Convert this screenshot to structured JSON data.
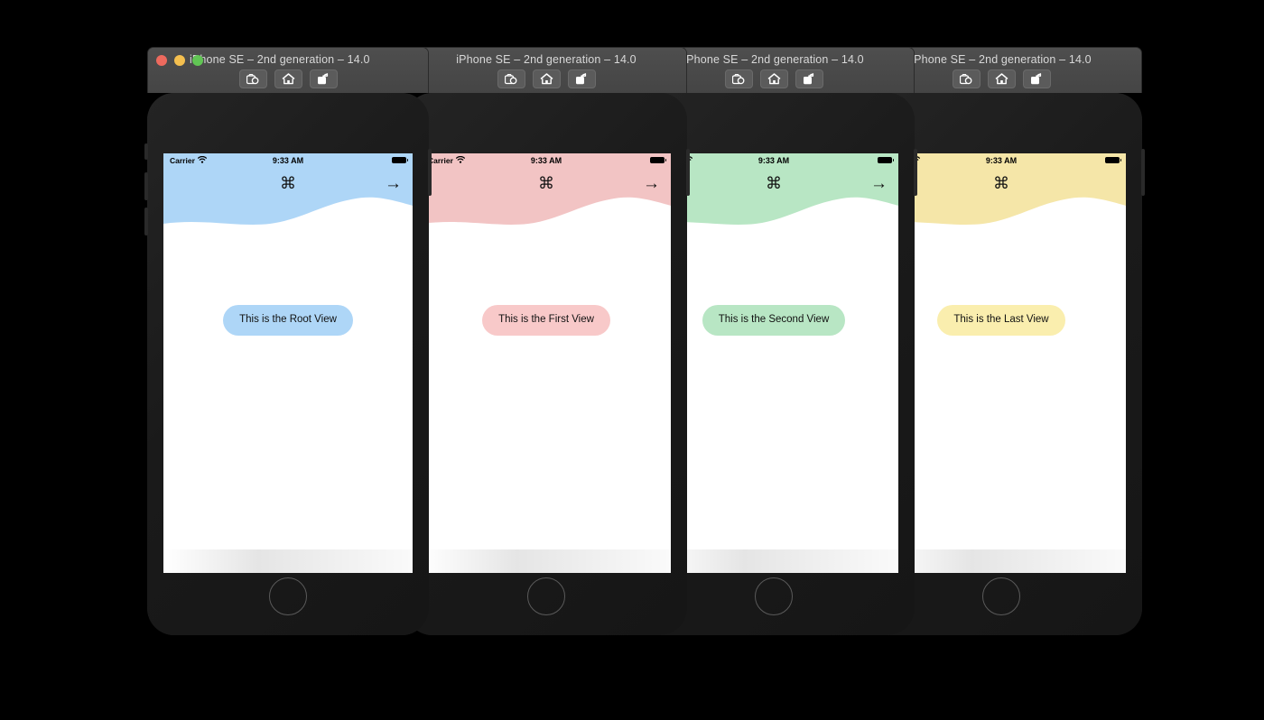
{
  "window": {
    "title": "iPhone SE – 2nd generation – 14.0",
    "traffic_lights": [
      {
        "name": "close",
        "color": "#ed6a5e"
      },
      {
        "name": "minimize",
        "color": "#f4bf4f"
      },
      {
        "name": "zoom",
        "color": "#61c554"
      }
    ],
    "toolbar_buttons": [
      {
        "name": "screenshot",
        "icon": "camera-icon"
      },
      {
        "name": "home",
        "icon": "home-icon"
      },
      {
        "name": "rotate",
        "icon": "rotate-icon"
      }
    ]
  },
  "status_bar": {
    "carrier": "Carrier",
    "wifi_icon": "wifi-icon",
    "time": "9:33 AM",
    "battery_icon": "battery-icon"
  },
  "nav": {
    "command_glyph": "⌘",
    "next_glyph": "→"
  },
  "simulators": [
    {
      "id": "root",
      "title": "iPhone SE – 2nd generation – 14.0",
      "focused": true,
      "header_color": "#AED6F7",
      "pill_color": "#AED6F7",
      "pill_label": "This is the Root View",
      "has_next": true
    },
    {
      "id": "first",
      "title": "iPhone SE – 2nd generation – 14.0",
      "focused": false,
      "header_color": "#F2C4C4",
      "pill_color": "#F8C9C9",
      "pill_label": "This is the First View",
      "has_next": true
    },
    {
      "id": "second",
      "title": "iPhone SE – 2nd generation – 14.0",
      "focused": false,
      "header_color": "#B8E6C4",
      "pill_color": "#B8E6C4",
      "pill_label": "This is the Second View",
      "has_next": true
    },
    {
      "id": "last",
      "title": "iPhone SE – 2nd generation – 14.0",
      "focused": false,
      "header_color": "#F5E6A8",
      "pill_color": "#FAEEAE",
      "pill_label": "This is the Last View",
      "has_next": false
    }
  ]
}
